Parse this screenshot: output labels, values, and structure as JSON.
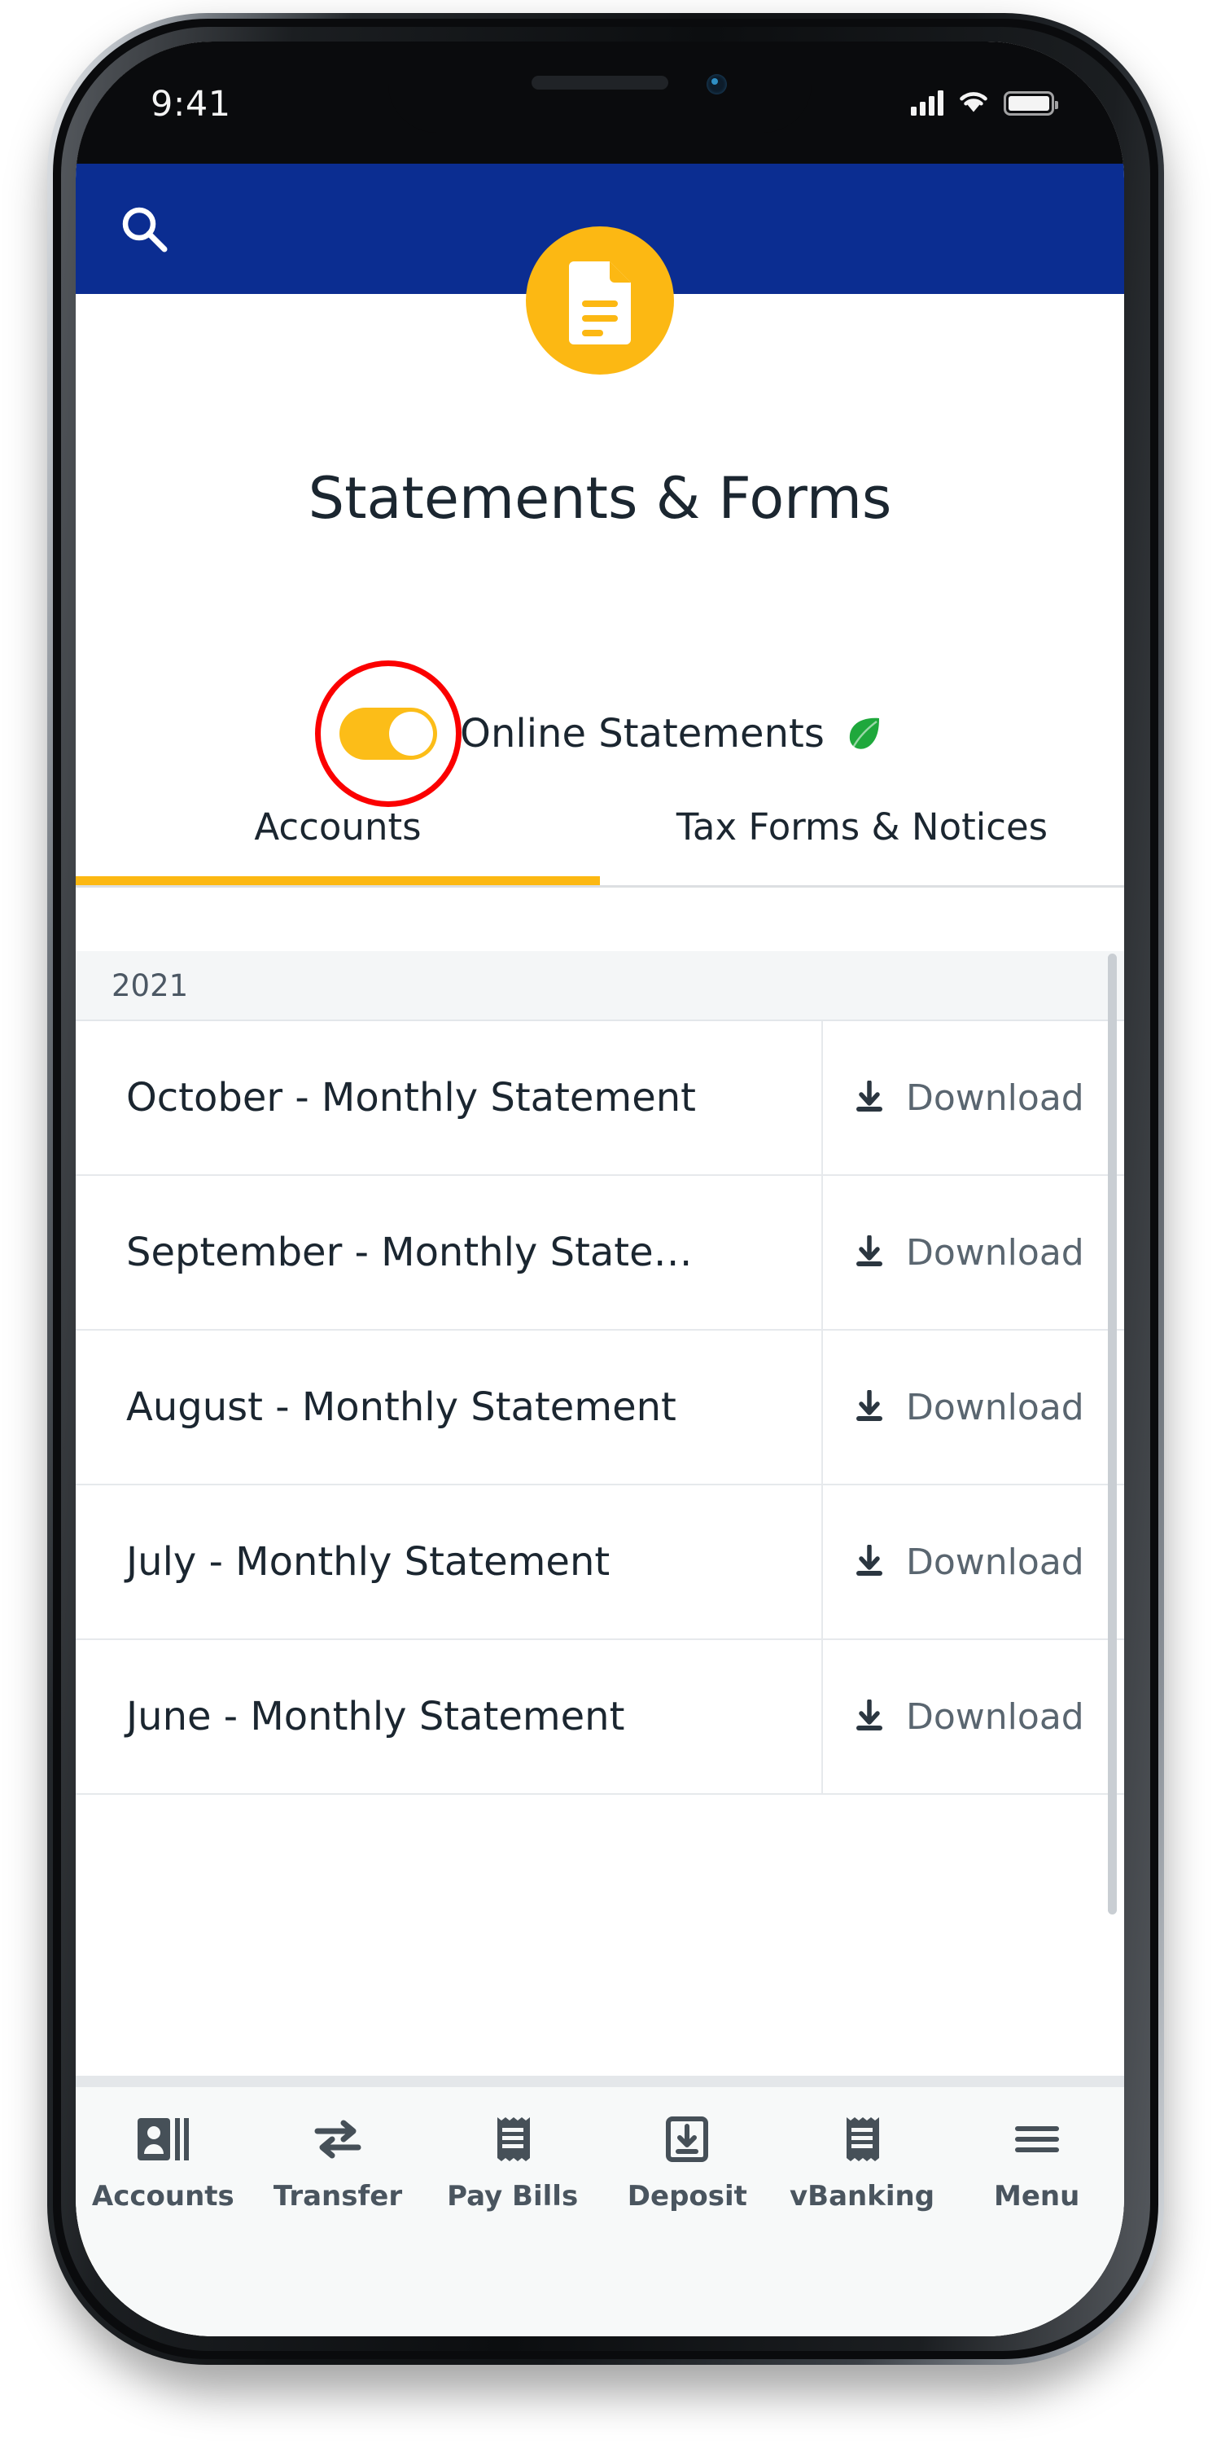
{
  "status_bar": {
    "time": "9:41",
    "signal_icon": "cellular-signal-icon",
    "wifi_icon": "wifi-icon",
    "battery_icon": "battery-icon"
  },
  "app_header": {
    "search_icon": "search-icon",
    "logo_icon": "document-logo-icon",
    "background_color": "#0b2d91",
    "accent_color": "#fcb813"
  },
  "page": {
    "title": "Statements & Forms"
  },
  "online_statements": {
    "label": "Online Statements",
    "toggle_state": "on",
    "toggle_color": "#fcbd18",
    "highlight_color": "#fb0000",
    "leaf_icon": "leaf-icon",
    "leaf_color": "#1fa83c"
  },
  "tabs": [
    {
      "label": "Accounts",
      "active": true
    },
    {
      "label": "Tax Forms & Notices",
      "active": false
    }
  ],
  "statements": {
    "year_header": "2021",
    "download_label": "Download",
    "download_icon": "download-icon",
    "rows": [
      {
        "name": "October - Monthly Statement"
      },
      {
        "name": "September - Monthly State…"
      },
      {
        "name": "August - Monthly Statement"
      },
      {
        "name": "July - Monthly Statement"
      },
      {
        "name": "June - Monthly Statement"
      }
    ]
  },
  "bottom_nav": [
    {
      "label": "Accounts",
      "icon": "contact-card-icon",
      "active": true
    },
    {
      "label": "Transfer",
      "icon": "transfer-arrows-icon",
      "active": false
    },
    {
      "label": "Pay Bills",
      "icon": "receipt-icon",
      "active": false
    },
    {
      "label": "Deposit",
      "icon": "deposit-box-icon",
      "active": false
    },
    {
      "label": "vBanking",
      "icon": "receipt-icon",
      "active": false
    },
    {
      "label": "Menu",
      "icon": "hamburger-menu-icon",
      "active": false
    }
  ]
}
